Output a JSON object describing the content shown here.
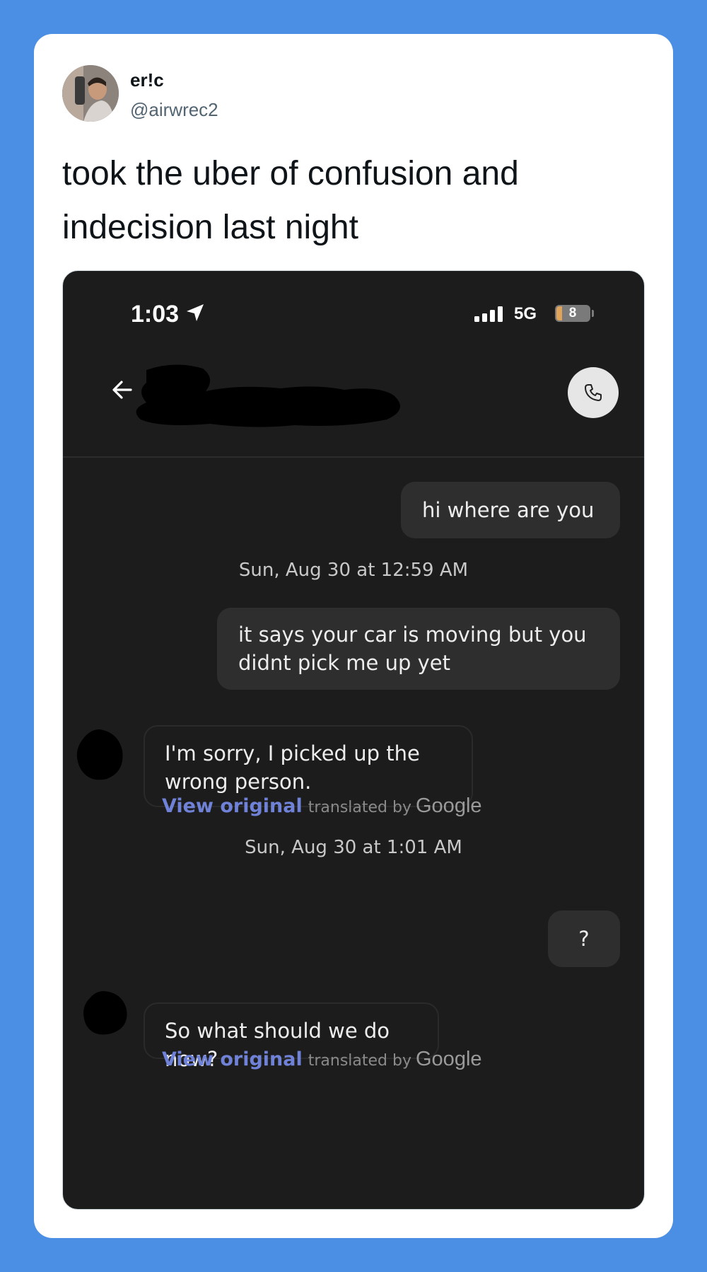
{
  "tweet": {
    "display_name": "er!c",
    "handle": "@airwrec2",
    "text": "took the uber of confusion and indecision last night"
  },
  "phone": {
    "status_bar": {
      "time": "1:03",
      "network": "5G",
      "battery": "8"
    },
    "header": {
      "back_icon": "arrow-left-icon",
      "call_icon": "phone-icon"
    },
    "messages": [
      {
        "type": "outgoing",
        "text": "hi where are you"
      },
      {
        "type": "timestamp",
        "text": "Sun, Aug 30 at 12:59 AM"
      },
      {
        "type": "outgoing",
        "text": "it says your car is moving but you didnt pick me up yet"
      },
      {
        "type": "incoming",
        "text": "I'm sorry, I picked up the wrong person."
      },
      {
        "type": "translation",
        "view_original": "View original",
        "translated_by": "translated by",
        "google": "Google"
      },
      {
        "type": "timestamp",
        "text": "Sun, Aug 30 at 1:01 AM"
      },
      {
        "type": "outgoing",
        "text": "?"
      },
      {
        "type": "incoming",
        "text": "So what should we do now?"
      },
      {
        "type": "translation",
        "view_original": "View original",
        "translated_by": "translated by",
        "google": "Google"
      }
    ]
  },
  "colors": {
    "page_background": "#4a8fe3",
    "card_background": "#ffffff",
    "chat_background": "#1c1c1c",
    "outgoing_bubble": "#2e2e2e",
    "link": "#6f82d8"
  }
}
